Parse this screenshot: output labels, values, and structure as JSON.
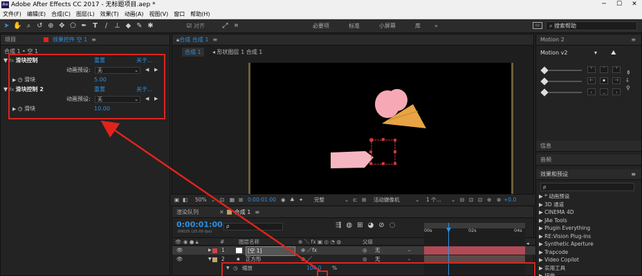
{
  "window": {
    "title": "Adobe After Effects CC 2017 - 无标题项目.aep *",
    "app_icon": "Ae",
    "controls": [
      "─",
      "☐",
      "✕"
    ]
  },
  "menu": [
    "文件(F)",
    "编辑(E)",
    "合成(C)",
    "图层(L)",
    "效果(T)",
    "动画(A)",
    "视图(V)",
    "窗口",
    "帮助(H)"
  ],
  "toolbar": {
    "snap_label": "对齐",
    "workspaces": [
      "必要项",
      "标准",
      "小屏幕",
      "库"
    ],
    "search_placeholder": "搜索帮助"
  },
  "left_panel": {
    "tabs": [
      "项目",
      "效果控件 空 1"
    ],
    "breadcrumb": "合成 1 • 空 1",
    "effects": [
      {
        "name": "滑块控制",
        "reset": "重置",
        "about": "关于...",
        "preset_label": "动画预设:",
        "preset_value": "无",
        "slider_label": "滑块",
        "slider_value": "5.00"
      },
      {
        "name": "滑块控制 2",
        "reset": "重置",
        "about": "关于...",
        "preset_label": "动画预设:",
        "preset_value": "无",
        "slider_label": "滑块",
        "slider_value": "10.00"
      }
    ]
  },
  "comp_panel": {
    "tab": "合成 合成 1",
    "breadcrumbs": [
      "合成 1",
      "形状图层 1 合成 1"
    ],
    "zoom": "50%",
    "time": "0:00:01:00",
    "quality": "完整",
    "camera": "活动摄像机",
    "views": "1 个...",
    "exposure": "+0.0"
  },
  "timeline": {
    "tabs": [
      "渲染队列",
      "合成 1"
    ],
    "timecode": "0:00:01:00",
    "fps": "00025 (25.00 fps)",
    "search_placeholder": "ρ",
    "columns": {
      "num": "#",
      "name": "图层名称",
      "parent": "父级"
    },
    "rulers": [
      "00s",
      "02s",
      "04s"
    ],
    "layers": [
      {
        "num": "1",
        "name": "[空 1]",
        "parent": "无",
        "color": "#c7474a"
      },
      {
        "num": "2",
        "name": "正方形",
        "parent": "无",
        "color": "#c7a36c"
      }
    ],
    "prop_label": "缩放",
    "prop_value": "104.0",
    "prop_unit": "%"
  },
  "right_panel": {
    "motion_tab": "Motion 2",
    "motion_dropdown": "Motion v2",
    "info": "信息",
    "audio": "音频",
    "effects_presets": "效果和预设",
    "search_placeholder": "ρ",
    "list": [
      "* 动画预设",
      "3D 通道",
      "CINEMA 4D",
      "JAe Tools",
      "Plugin Everything",
      "RE:Vision Plug-ins",
      "Synthetic Aperture",
      "Trapcode",
      "Video Copilot",
      "实用工具",
      "扭曲"
    ]
  },
  "colors": {
    "accent": "#2f8fe0",
    "annotation": "#e0241d",
    "ice_cream": "#f6a9b5",
    "cone": "#e8a444"
  }
}
